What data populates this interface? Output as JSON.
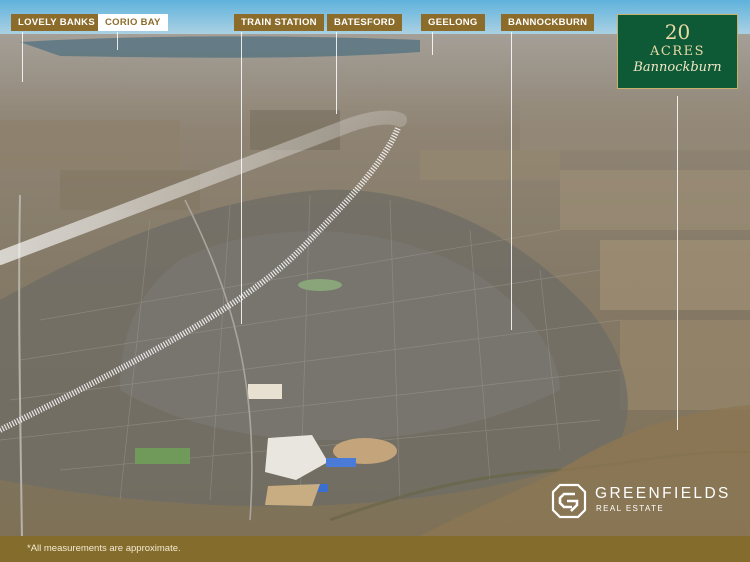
{
  "locations": {
    "lovely_banks": "LOVELY BANKS",
    "corio_bay": "CORIO BAY",
    "train_station": "TRAIN STATION",
    "batesford": "BATESFORD",
    "geelong": "GEELONG",
    "bannockburn": "BANNOCKBURN"
  },
  "property": {
    "size_number": "20",
    "size_unit": "ACRES",
    "locality": "Bannockburn"
  },
  "brand": {
    "name": "GREENFIELDS",
    "tagline": "REAL ESTATE"
  },
  "disclaimer": "*All measurements are approximate.",
  "colors": {
    "label_gold": "#8c6c2a",
    "badge_green": "#0f5a36",
    "footer_gold": "#846c2c"
  }
}
